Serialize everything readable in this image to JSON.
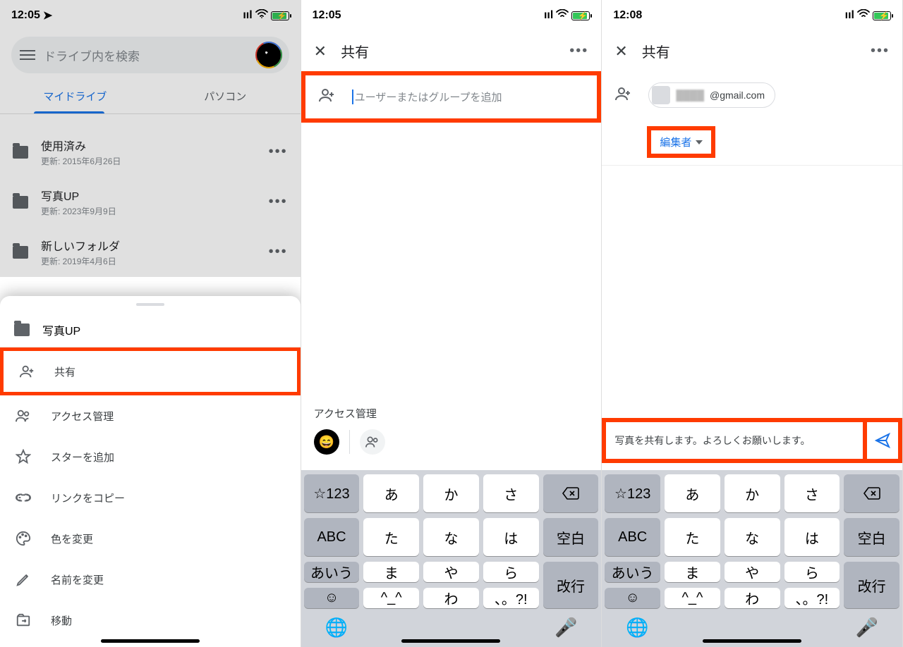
{
  "panel1": {
    "time": "12:05",
    "search_placeholder": "ドライブ内を検索",
    "tabs": {
      "mydrive": "マイドライブ",
      "computers": "パソコン"
    },
    "files": [
      {
        "name": "使用済み",
        "meta": "更新: 2015年6月26日"
      },
      {
        "name": "写真UP",
        "meta": "更新: 2023年9月9日"
      },
      {
        "name": "新しいフォルダ",
        "meta": "更新: 2019年4月6日"
      }
    ],
    "sheet": {
      "title": "写真UP",
      "items": {
        "share": "共有",
        "manage_access": "アクセス管理",
        "star": "スターを追加",
        "copy_link": "リンクをコピー",
        "change_color": "色を変更",
        "rename": "名前を変更",
        "move": "移動"
      }
    }
  },
  "panel2": {
    "time": "12:05",
    "title": "共有",
    "placeholder": "ユーザーまたはグループを追加",
    "access_label": "アクセス管理"
  },
  "panel3": {
    "time": "12:08",
    "title": "共有",
    "email": "@gmail.com",
    "role": "編集者",
    "message": "写真を共有します。よろしくお願いします。"
  },
  "keyboard": {
    "num": "☆123",
    "abc": "ABC",
    "kana": "あいう",
    "r1": [
      "あ",
      "か",
      "さ"
    ],
    "r2": [
      "た",
      "な",
      "は"
    ],
    "r3": [
      "ま",
      "や",
      "ら"
    ],
    "r4": [
      "^_^",
      "わ",
      "、。?!"
    ],
    "space": "空白",
    "return": "改行"
  }
}
